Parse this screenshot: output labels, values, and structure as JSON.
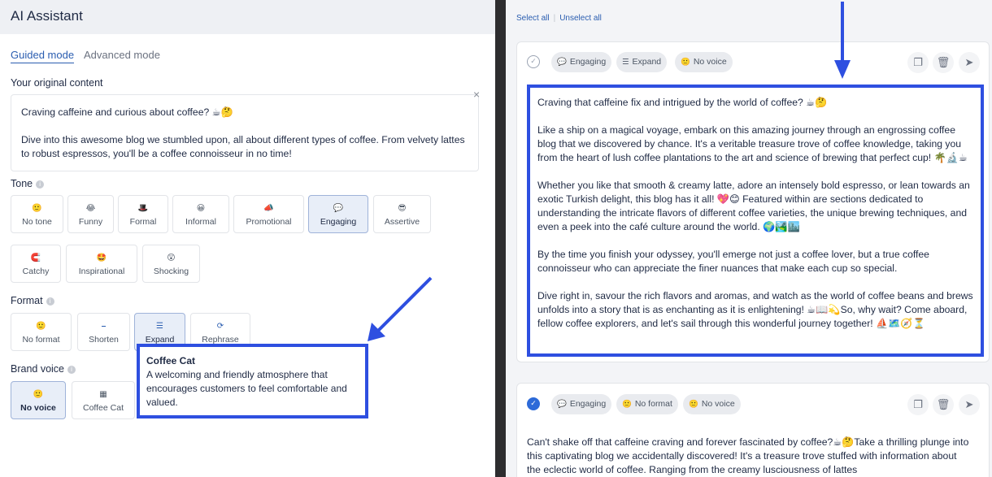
{
  "left": {
    "title": "AI Assistant",
    "modes": [
      {
        "label": "Guided mode"
      },
      {
        "label": "Advanced mode"
      }
    ],
    "original_label": "Your original content",
    "original_content": [
      "Craving caffeine and curious about coffee? ☕🤔",
      "Dive into this awesome blog we stumbled upon, all about different types of coffee. From velvety lattes to robust espressos, you'll be a coffee connoisseur in no time!"
    ],
    "close_icon": "×",
    "tone_label": "Tone",
    "tone_chips": [
      {
        "icon": "🙂",
        "label": "No tone"
      },
      {
        "icon": "😂",
        "label": "Funny"
      },
      {
        "icon": "🎩",
        "label": "Formal"
      },
      {
        "icon": "😀",
        "label": "Informal"
      },
      {
        "icon": "📣",
        "label": "Promotional"
      },
      {
        "icon": "💬",
        "label": "Engaging"
      },
      {
        "icon": "😎",
        "label": "Assertive"
      },
      {
        "icon": "🧲",
        "label": "Catchy"
      },
      {
        "icon": "🤩",
        "label": "Inspirational"
      },
      {
        "icon": "😲",
        "label": "Shocking"
      }
    ],
    "format_label": "Format",
    "format_chips": [
      {
        "icon": "🙂",
        "label": "No format"
      },
      {
        "icon": "⎯",
        "label": "Shorten"
      },
      {
        "icon": "☰",
        "label": "Expand"
      },
      {
        "icon": "⟳",
        "label": "Rephrase"
      }
    ],
    "brand_voice_label": "Brand voice",
    "brand_chips": [
      {
        "icon": "🙂",
        "label": "No voice"
      },
      {
        "icon": "▦",
        "label": "Coffee Cat"
      }
    ],
    "tooltip": {
      "title": "Coffee Cat",
      "body": "A welcoming and friendly atmosphere that encourages customers to feel comfortable and valued."
    }
  },
  "right": {
    "select_all": "Select all",
    "unselect_all": "Unselect all",
    "card1": {
      "check": "✓",
      "pills": [
        {
          "icon": "💬",
          "label": "Engaging"
        },
        {
          "icon": "☰",
          "label": "Expand"
        },
        {
          "icon": "🙂",
          "label": "No voice"
        }
      ],
      "actions": [
        "copy-icon",
        "trash-icon",
        "send-icon"
      ],
      "paragraphs": [
        "Craving that caffeine fix and intrigued by the world of coffee? ☕🤔",
        "Like a ship on a magical voyage, embark on this amazing journey through an engrossing coffee blog that we discovered by chance. It's a veritable treasure trove of coffee knowledge, taking you from the heart of lush coffee plantations to the art and science of brewing that perfect cup! 🌴🔬☕",
        "Whether you like that smooth & creamy latte, adore an intensely bold espresso, or lean towards an exotic Turkish delight, this blog has it all! 💖😊 Featured within are sections dedicated to understanding the intricate flavors of different coffee varieties, the unique brewing techniques, and even a peek into the café culture around the world. 🌍🏞️🏙️",
        "By the time you finish your odyssey, you'll emerge not just a coffee lover, but a true coffee connoisseur who can appreciate the finer nuances that make each cup so special.",
        "Dive right in, savour the rich flavors and aromas, and watch as the world of coffee beans and brews unfolds into a story that is as enchanting as it is enlightening! ☕📖💫So, why wait? Come aboard, fellow coffee explorers, and let's sail through this wonderful journey together! ⛵🗺️🧭⏳"
      ]
    },
    "card2": {
      "check": "✓",
      "pills": [
        {
          "icon": "💬",
          "label": "Engaging"
        },
        {
          "icon": "🙂",
          "label": "No format"
        },
        {
          "icon": "🙂",
          "label": "No voice"
        }
      ],
      "actions": [
        "copy-icon",
        "trash-icon",
        "send-icon"
      ],
      "text": "Can't shake off that caffeine craving and forever fascinated by coffee?☕🤔Take a thrilling plunge into this captivating blog we accidentally discovered! It's a treasure trove stuffed with information about the eclectic world of coffee. Ranging from the creamy lusciousness of lattes"
    }
  },
  "colors": {
    "accent": "#2a5db0",
    "highlight": "#2e4fe0",
    "selected_chip": "#e8eef8"
  }
}
